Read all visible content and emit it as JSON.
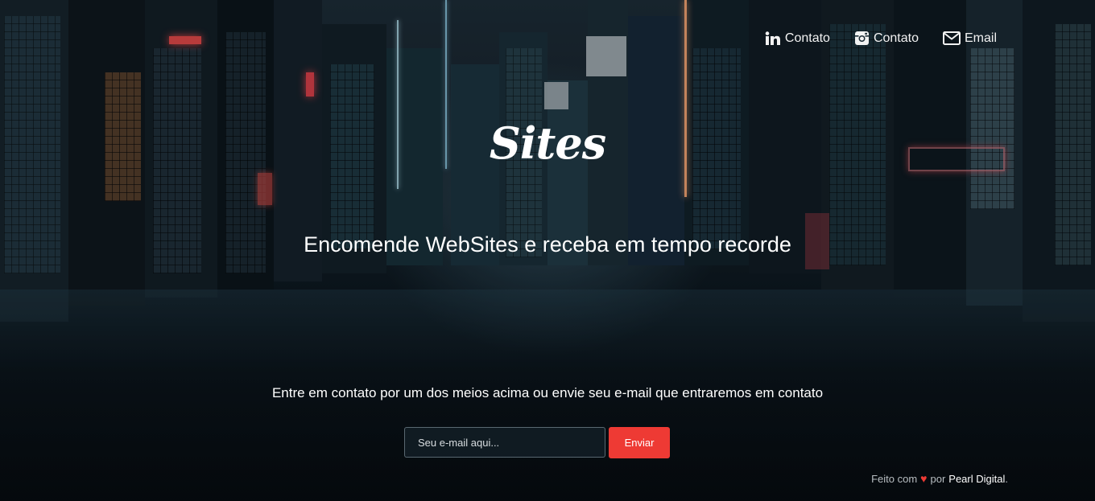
{
  "nav": [
    {
      "icon": "linkedin-icon",
      "label": "Contato"
    },
    {
      "icon": "instagram-icon",
      "label": "Contato"
    },
    {
      "icon": "envelope-icon",
      "label": "Email"
    }
  ],
  "logo_text": "Sites",
  "headline": "Encomende WebSites e receba em tempo recorde",
  "subtext": "Entre em contato por um dos meios acima ou envie seu e-mail que entraremos em contato",
  "form": {
    "email_placeholder": "Seu e-mail aqui...",
    "email_value": "",
    "submit_label": "Enviar"
  },
  "footer": {
    "prefix": "Feito com",
    "heart": "♥",
    "middle": "por",
    "brand": "Pearl Digital",
    "suffix": "."
  },
  "colors": {
    "accent": "#ee3a34",
    "text": "#ffffff"
  }
}
